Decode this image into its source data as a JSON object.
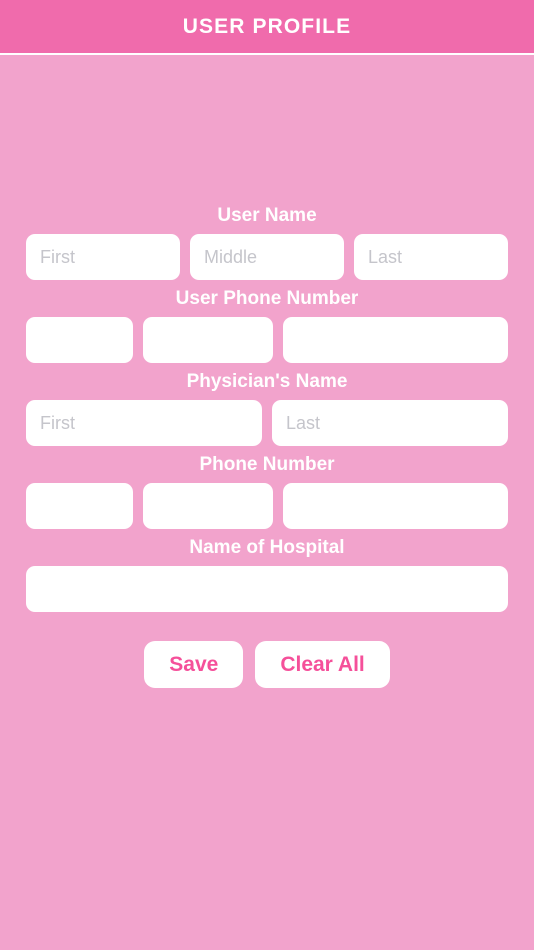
{
  "header": {
    "title": "USER PROFILE"
  },
  "colors": {
    "header_bg": "#F06BAC",
    "page_bg": "#F2A3CC",
    "field_bg": "#FFFFFF",
    "label_text": "#FFFFFF",
    "placeholder_text": "#C5C5CB",
    "button_text": "#F5509A"
  },
  "form": {
    "sections": [
      {
        "label": "User Name",
        "fields": [
          {
            "name": "user-first-name",
            "placeholder": "First",
            "value": ""
          },
          {
            "name": "user-middle-name",
            "placeholder": "Middle",
            "value": ""
          },
          {
            "name": "user-last-name",
            "placeholder": "Last",
            "value": ""
          }
        ]
      },
      {
        "label": "User Phone Number",
        "fields": [
          {
            "name": "user-phone-area-code",
            "placeholder": "",
            "value": ""
          },
          {
            "name": "user-phone-prefix",
            "placeholder": "",
            "value": ""
          },
          {
            "name": "user-phone-line-number",
            "placeholder": "",
            "value": ""
          }
        ]
      },
      {
        "label": "Physician's Name",
        "fields": [
          {
            "name": "physician-first-name",
            "placeholder": "First",
            "value": ""
          },
          {
            "name": "physician-last-name",
            "placeholder": "Last",
            "value": ""
          }
        ]
      },
      {
        "label": "Phone Number",
        "fields": [
          {
            "name": "physician-phone-area-code",
            "placeholder": "",
            "value": ""
          },
          {
            "name": "physician-phone-prefix",
            "placeholder": "",
            "value": ""
          },
          {
            "name": "physician-phone-line-number",
            "placeholder": "",
            "value": ""
          }
        ]
      },
      {
        "label": "Name of Hospital",
        "fields": [
          {
            "name": "hospital-name",
            "placeholder": "",
            "value": ""
          }
        ]
      }
    ]
  },
  "buttons": {
    "save_label": "Save",
    "clear_label": "Clear All"
  }
}
